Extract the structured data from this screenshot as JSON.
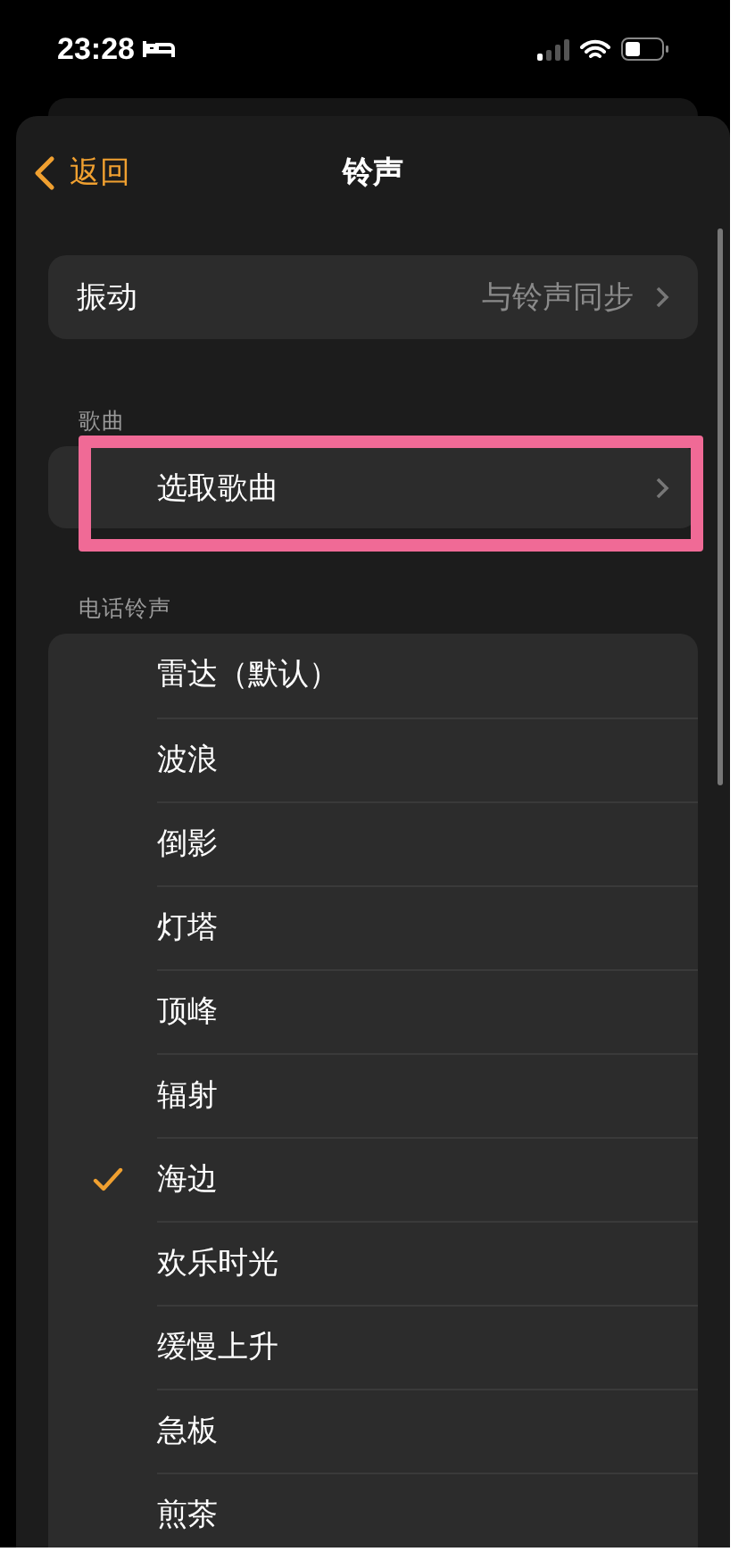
{
  "status_bar": {
    "time": "23:28"
  },
  "nav": {
    "back": "返回",
    "title": "铃声"
  },
  "vibration": {
    "label": "振动",
    "value": "与铃声同步"
  },
  "songs": {
    "header": "歌曲",
    "item": {
      "label": "选取歌曲",
      "highlighted": true
    }
  },
  "ringtones": {
    "header": "电话铃声",
    "items": [
      {
        "name": "雷达（默认）",
        "selected": false
      },
      {
        "name": "波浪",
        "selected": false
      },
      {
        "name": "倒影",
        "selected": false
      },
      {
        "name": "灯塔",
        "selected": false
      },
      {
        "name": "顶峰",
        "selected": false
      },
      {
        "name": "辐射",
        "selected": false
      },
      {
        "name": "海边",
        "selected": true
      },
      {
        "name": "欢乐时光",
        "selected": false
      },
      {
        "name": "缓慢上升",
        "selected": false
      },
      {
        "name": "急板",
        "selected": false
      },
      {
        "name": "煎茶",
        "selected": false
      }
    ]
  }
}
